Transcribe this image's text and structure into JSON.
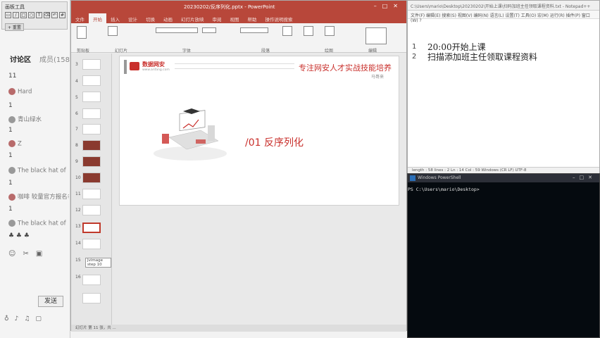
{
  "chat": {
    "toolbar_title": "画板工具",
    "reset_label": "+ 重置",
    "tabs": [
      "讨论区",
      "成员(158"
    ],
    "messages": [
      {
        "user": "",
        "text": "11"
      },
      {
        "user": "Hard",
        "text": "1"
      },
      {
        "user": "青山绿水",
        "text": "1"
      },
      {
        "user": "Z",
        "text": "1"
      },
      {
        "user": "The black hat of",
        "text": "1"
      },
      {
        "user": "咖啡 较量官方报名名",
        "text": "1"
      },
      {
        "user": "The black hat of",
        "text": "♣ ♣ ♣"
      }
    ],
    "send_label": "发送"
  },
  "ppt": {
    "title": "20230202/反序列化.pptx - PowerPoint",
    "ribbon_tabs": [
      "文件",
      "开始",
      "插入",
      "设计",
      "切换",
      "动画",
      "幻灯片放映",
      "审阅",
      "视图",
      "帮助",
      "操作说明搜索"
    ],
    "active_tab": "开始",
    "groups": [
      "剪贴板",
      "幻灯片",
      "字体",
      "段落",
      "绘图",
      "编辑"
    ],
    "slide_numbers": [
      "3",
      "4",
      "5",
      "6",
      "7",
      "8",
      "9",
      "10",
      "11",
      "12",
      "13",
      "14",
      "15",
      "16"
    ],
    "tooltip": "Jvimage step 10",
    "slide": {
      "logo": "数据网安",
      "logo_sub": "www.anfang.com",
      "slogan": "专注网安人才实战技能培养",
      "presenter": "马哥来",
      "section": "/01 反序列化"
    },
    "status": "幻灯片 第 11 张，共 ..."
  },
  "notepad": {
    "title": "C:\\Users\\mario\\Desktop\\20230202\\开始上课\\扫码加班主任领取课程资料.txt - Notepad++",
    "menu": "文件(F) 编辑(E) 搜索(S) 视图(V) 编码(N) 语言(L) 设置(T) 工具(O) 宏(M) 运行(R) 插件(P) 窗口(W) ?",
    "lines": [
      {
        "num": "1",
        "text": "20:00开始上课"
      },
      {
        "num": "2",
        "text": "扫描添加班主任领取课程资料"
      }
    ],
    "status": "length : 58    lines : 2    Ln : 14    Col : 59    Windows (CR LF)    UTF-8"
  },
  "powershell": {
    "title": "Windows PowerShell",
    "prompt": "PS C:\\Users\\mario\\Desktop>"
  }
}
